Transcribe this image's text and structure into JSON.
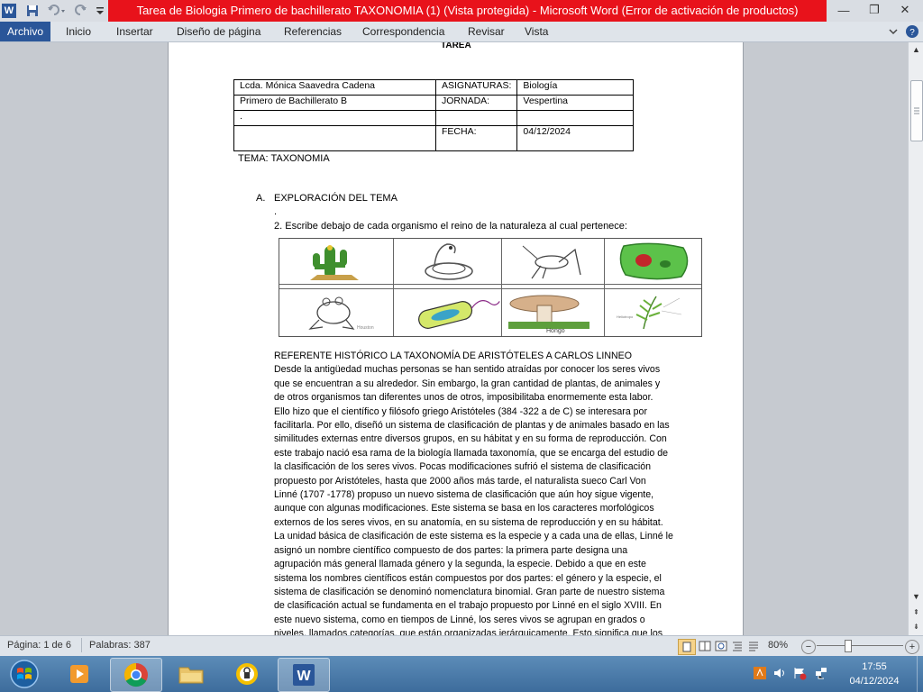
{
  "window": {
    "title": "Tarea de Biologia Primero de bachillerato  TAXONOMIA (1) (Vista protegida)  -  Microsoft Word (Error de activación de productos)",
    "quick_access": {
      "word_icon": "W",
      "save": "save-icon",
      "undo": "undo-icon",
      "redo": "redo-icon"
    },
    "controls": {
      "minimize": "—",
      "restore": "❐",
      "close": "✕"
    }
  },
  "ribbon": {
    "tabs": [
      "Archivo",
      "Inicio",
      "Insertar",
      "Diseño de página",
      "Referencias",
      "Correspondencia",
      "Revisar",
      "Vista"
    ],
    "accent": "#2a5699"
  },
  "document": {
    "header_cut": "TAREA",
    "table": [
      [
        "Lcda. Mónica Saavedra Cadena",
        "ASIGNATURAS:",
        "Biología"
      ],
      [
        "Primero de   Bachillerato B",
        "JORNADA:",
        "Vespertina"
      ],
      [
        ".",
        "",
        ""
      ],
      [
        "",
        "FECHA:",
        "04/12/2024"
      ]
    ],
    "tema": "TEMA: TAXONOMIA",
    "section_letter": "A.",
    "section_title": "EXPLORACIÓN DEL TEMA",
    "dot": ".",
    "instruction": "2. Escribe debajo de cada organismo el reino de la naturaleza al cual pertenece:",
    "images": [
      "cactus",
      "snake",
      "grasshopper",
      "plant-cell",
      "frog",
      "bacterium",
      "mushroom",
      "fern"
    ],
    "mushroom_caption": "Hongo",
    "frog_caption": "Houston",
    "fern_caption": "Heliotropo",
    "paragraph_title": "REFERENTE HISTÓRICO LA TAXONOMÍA DE ARISTÓTELES A CARLOS LINNEO",
    "paragraph_lines": [
      "Desde la antigüedad muchas personas se han sentido atraídas por conocer los seres vivos",
      "que se encuentran a su alrededor. Sin embargo, la gran cantidad de plantas, de animales y",
      "de otros organismos tan diferentes unos de otros, imposibilitaba enormemente esta labor.",
      "Ello hizo que el científico y filósofo griego Aristóteles (384 -322 a de C) se interesara por",
      "facilitarla. Por ello, diseñó un sistema de clasificación de plantas y de animales basado en las",
      "similitudes externas entre diversos grupos, en su hábitat y en su forma de reproducción.  Con",
      "este trabajo nació esa rama de la biología llamada taxonomía, que se encarga del estudio de",
      "la clasificación de los seres vivos. Pocas modificaciones sufrió el sistema de clasificación",
      "propuesto por Aristóteles, hasta que 2000 años más tarde, el naturalista sueco Carl Von",
      "Linné (1707 -1778) propuso un nuevo sistema de clasificación que aún hoy sigue vigente,",
      "aunque con algunas modificaciones. Este sistema se basa en los caracteres morfológicos",
      "externos de los seres vivos, en su anatomía, en su sistema de reproducción y en su hábitat.",
      "La unidad básica de clasificación de este sistema es la especie y a cada una de ellas, Linné le",
      "asignó un nombre científico compuesto de dos partes: la primera parte designa una",
      "agrupación más general llamada género y la segunda, la especie. Debido a que en este",
      "sistema los nombres científicos están compuestos por dos partes: el género y la especie, el",
      "sistema de clasificación se denominó nomenclatura binomial. Gran parte de nuestro sistema",
      "de clasificación actual se fundamenta en el trabajo propuesto por Linné en el siglo XVIII. En",
      "este nuevo sistema, como en tiempos de Linné, los seres vivos se agrupan en grados o",
      "niveles, llamados categorías, que están organizadas jerárquicamente. Esto significa que los"
    ]
  },
  "status_bar": {
    "page": "Página: 1 de 6",
    "words": "Palabras: 387",
    "zoom": "80%",
    "zoom_level": 0.8
  },
  "taskbar": {
    "time": "17:55",
    "date": "04/12/2024",
    "apps": [
      "start",
      "media-player",
      "chrome",
      "file-explorer",
      "security-app",
      "word"
    ]
  }
}
